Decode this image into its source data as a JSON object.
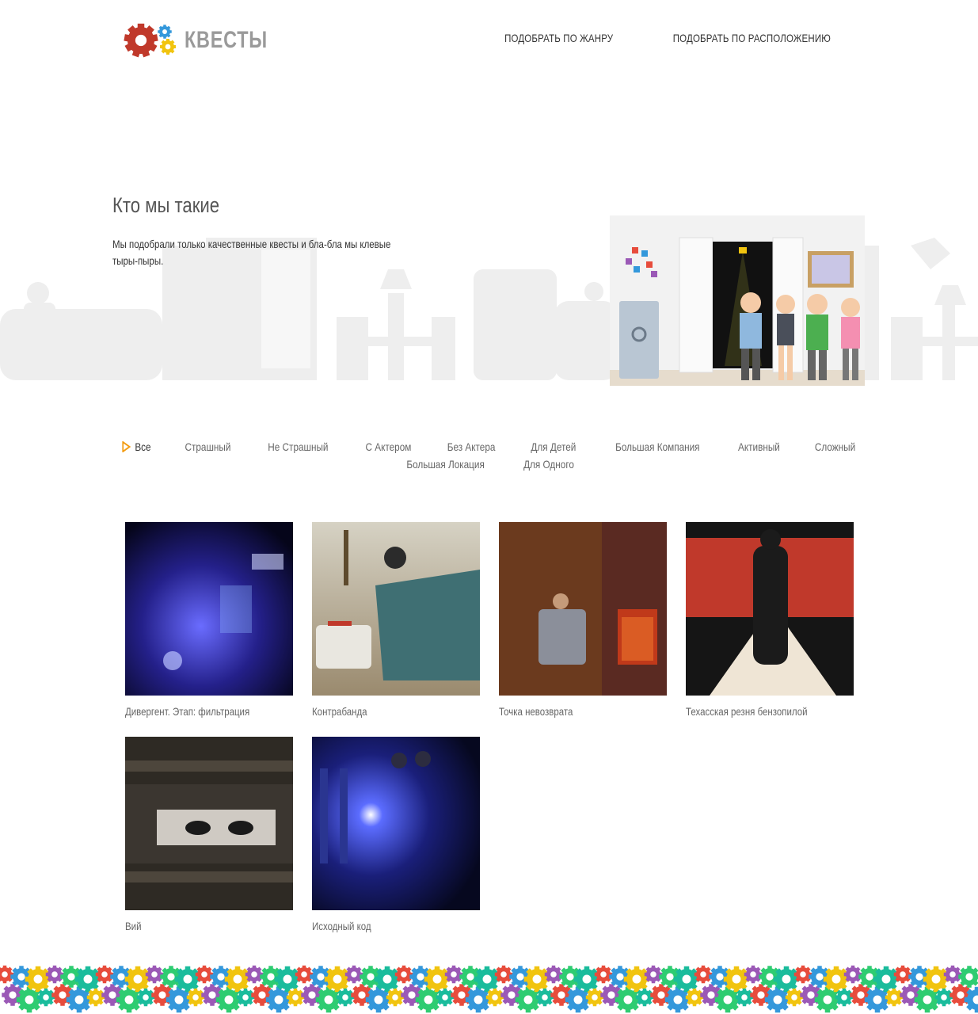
{
  "brand": {
    "name": "КВЕСТЫ",
    "gear_colors": [
      "#c0392b",
      "#3498db",
      "#f1c40f"
    ]
  },
  "nav": {
    "items": [
      {
        "label": "ПОДОБРАТЬ ПО ЖАНРУ"
      },
      {
        "label": "ПОДОБРАТЬ ПО РАСПОЛОЖЕНИЮ"
      }
    ]
  },
  "about": {
    "title": "Кто мы такие",
    "text": "Мы подобрали только качественные квесты и бла-бла мы клевые тыры-пыры."
  },
  "filters": {
    "accent": "#f39c12",
    "items": [
      {
        "label": "Все",
        "active": true
      },
      {
        "label": "Страшный"
      },
      {
        "label": "Не Страшный"
      },
      {
        "label": "С Актером"
      },
      {
        "label": "Без Актера"
      },
      {
        "label": "Для Детей"
      },
      {
        "label": "Большая Компания"
      },
      {
        "label": "Активный"
      },
      {
        "label": "Сложный"
      },
      {
        "label": "Большая Локация"
      },
      {
        "label": "Для Одного"
      }
    ]
  },
  "quests": [
    {
      "title": "Дивергент. Этап: фильтрация",
      "image": "neon-blue-scene"
    },
    {
      "title": "Контрабанда",
      "image": "car-chase-scene"
    },
    {
      "title": "Точка невозврата",
      "image": "man-in-armchair-scene"
    },
    {
      "title": "Техасская резня бензопилой",
      "image": "chainsaw-poster"
    },
    {
      "title": "Вий",
      "image": "eyes-behind-boards"
    },
    {
      "title": "Исходный код",
      "image": "flashlight-in-dark"
    }
  ],
  "footer": {
    "gear_colors": [
      "#e74c3c",
      "#3498db",
      "#f1c40f",
      "#9b59b6",
      "#2ecc71",
      "#1abc9c"
    ]
  }
}
